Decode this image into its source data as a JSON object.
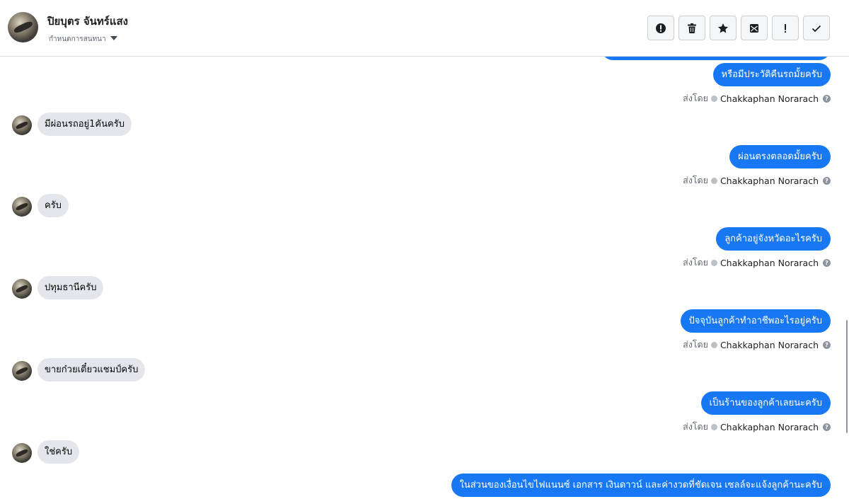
{
  "header": {
    "contact_name": "ปิยบุตร จันทร์แสง",
    "assign_label": "กำหนดการสนทนา"
  },
  "toolbar": {
    "buttons": [
      {
        "name": "alert-circle-button",
        "icon": "alert-circle-icon"
      },
      {
        "name": "delete-button",
        "icon": "trash-icon"
      },
      {
        "name": "star-button",
        "icon": "star-icon"
      },
      {
        "name": "mark-unread-button",
        "icon": "envelope-icon"
      },
      {
        "name": "priority-button",
        "icon": "exclamation-icon"
      },
      {
        "name": "mark-done-button",
        "icon": "checkmark-icon"
      }
    ]
  },
  "conversation": {
    "sent_prefix": "ส่งโดย",
    "agent_name": "Chakkaphan Norarach",
    "help_glyph": "?",
    "outgoing": [
      "หรือมีประวัติคืนรถมั้ยครับ",
      "ผ่อนตรงตลอดมั้ยครับ",
      "ลูกค้าอยู่จังหวัดอะไรครับ",
      "ปัจจุบันลูกค้าทำอาชีพอะไรอยู่ครับ",
      "เป็นร้านของลูกค้าเลยนะครับ",
      "ในส่วนของเงื่อนไขไฟแนนซ์ เอกสาร เงินดาวน์ และค่างวดที่ชัดเจน เซลล์จะแจ้งลูกค้านะครับ"
    ],
    "incoming": [
      "มีผ่อนรถอยู่1คันครับ",
      "ครับ",
      "ปทุมธานีครับ",
      "ขายก๋วยเตี๋ยวแชมป์ครับ",
      "ใช่ครับ"
    ]
  },
  "colors": {
    "outgoing_bubble": "#1877f2",
    "incoming_bubble": "#e4e6eb"
  }
}
